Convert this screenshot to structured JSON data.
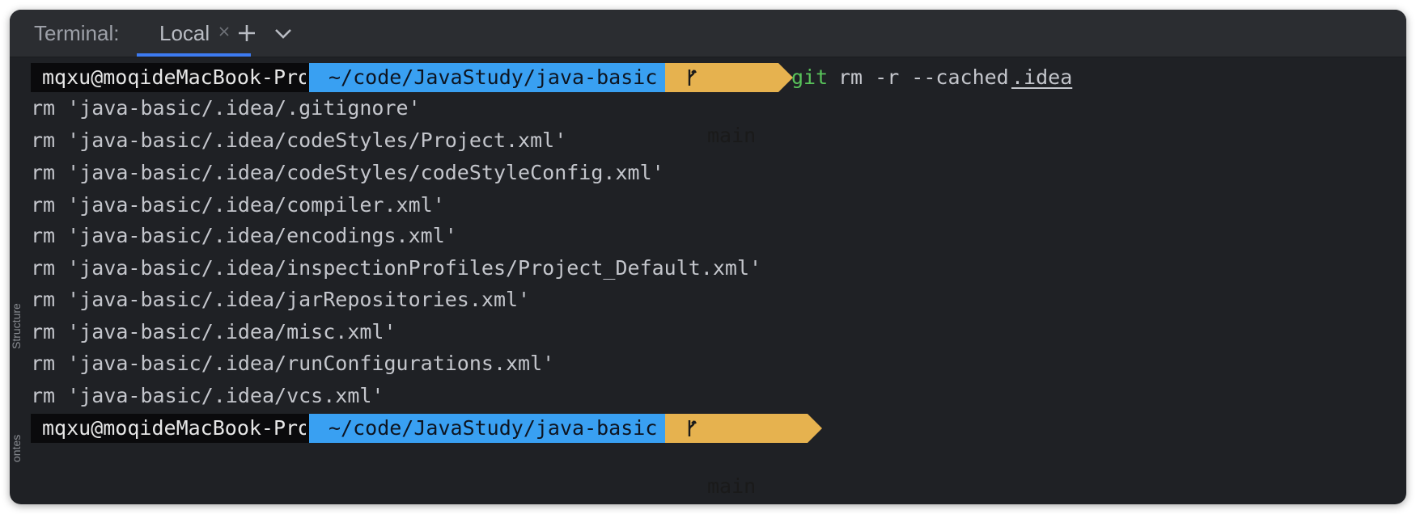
{
  "tabbar": {
    "label": "Terminal:",
    "active_tab": "Local",
    "add_icon": "plus-icon",
    "more_icon": "chevron-down-icon",
    "close_icon": "close-icon"
  },
  "colors": {
    "user_bg": "#0a0a0c",
    "path_bg": "#39a0f2",
    "branch_bg": "#e6b24f",
    "git_cmd": "#58c25a",
    "tab_underline": "#3d7bf2"
  },
  "prompt": {
    "user": "mqxu@moqideMacBook-Pro",
    "path": "~/code/JavaStudy/java-basic",
    "branch_icon": "git-branch-icon",
    "branch": "main"
  },
  "command": {
    "program": "git",
    "args": "rm -r --cached",
    "target": ".idea"
  },
  "output": [
    "rm 'java-basic/.idea/.gitignore'",
    "rm 'java-basic/.idea/codeStyles/Project.xml'",
    "rm 'java-basic/.idea/codeStyles/codeStyleConfig.xml'",
    "rm 'java-basic/.idea/compiler.xml'",
    "rm 'java-basic/.idea/encodings.xml'",
    "rm 'java-basic/.idea/inspectionProfiles/Project_Default.xml'",
    "rm 'java-basic/.idea/jarRepositories.xml'",
    "rm 'java-basic/.idea/misc.xml'",
    "rm 'java-basic/.idea/runConfigurations.xml'",
    "rm 'java-basic/.idea/vcs.xml'"
  ],
  "prompt2": {
    "branch_status": "✚"
  },
  "side": {
    "structure": "Structure",
    "other": "ontes"
  }
}
